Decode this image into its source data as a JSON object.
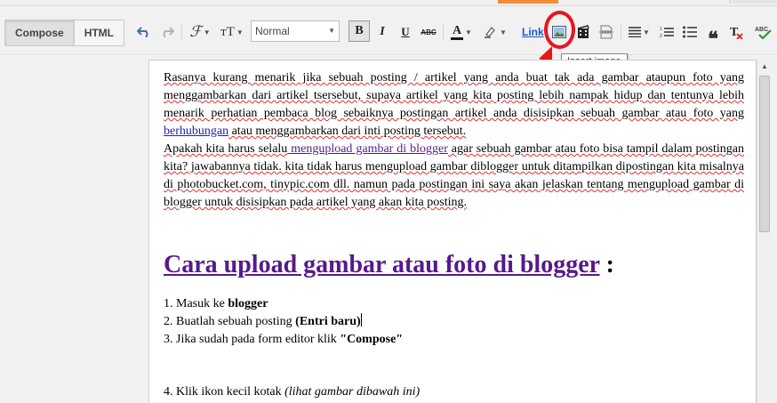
{
  "toolbar": {
    "mode_compose": "Compose",
    "mode_html": "HTML",
    "format_value": "Normal",
    "link_label": "Link",
    "tooltip": "Insert image"
  },
  "post": {
    "p1": {
      "a": "Rasanya kurang menarik jika sebuah posting / artikel yang anda buat tak ada gambar ataupun foto yang menggambarkan dari artikel tsersebut, supaya artikel yang kita posting lebih nampak hidup dan tentunya lebih menarik perhatian pembaca blog sebaiknya postingan artikel anda disisipkan sebuah gambar atau foto yang ",
      "link": "berhubungan",
      "b": " atau menggambarkan dari inti posting tersebut."
    },
    "p2": {
      "a": "Apakah kita harus selalu",
      "link": " mengupload gambar di blogger",
      "b": " agar sebuah gambar atau foto bisa tampil dalam postingan kita? jawabannya tidak. kita tidak harus mengupload gambar diblogger untuk ditampilkan dipostingan kita misalnya di photobucket.com, tinypic.com dll. namun pada postingan ini saya akan jelaskan tentang mengupload gambar di blogger untuk disisipkan pada artikel yang akan kita posting."
    },
    "heading": {
      "link": "Cara upload gambar atau foto di blogger",
      "suffix": " :"
    },
    "list": {
      "i1_prefix": "1. Masuk ke ",
      "i1_bold": "blogger",
      "i2_prefix": "2. Buatlah sebuah posting ",
      "i2_bold": "(Entri baru)",
      "i3_prefix": "3. Jika sudah pada form editor klik ",
      "i3_bold": "\"Compose\"",
      "i4_prefix": "4. Klik ikon kecil kotak ",
      "i4_italic": "(lihat gambar dibawah ini)"
    }
  },
  "icons": [
    "undo-icon",
    "redo-icon",
    "font-family-icon",
    "font-size-icon",
    "bold-icon",
    "italic-icon",
    "underline-icon",
    "strikethrough-icon",
    "text-color-icon",
    "highlight-color-icon",
    "insert-image-icon",
    "insert-video-icon",
    "insert-jump-break-icon",
    "align-icon",
    "numbered-list-icon",
    "bulleted-list-icon",
    "quote-icon",
    "remove-formatting-icon",
    "spell-check-icon"
  ],
  "colors": {
    "annotation": "#e8151b",
    "link": "#1a5bc4",
    "visited_link": "#551a8b"
  }
}
